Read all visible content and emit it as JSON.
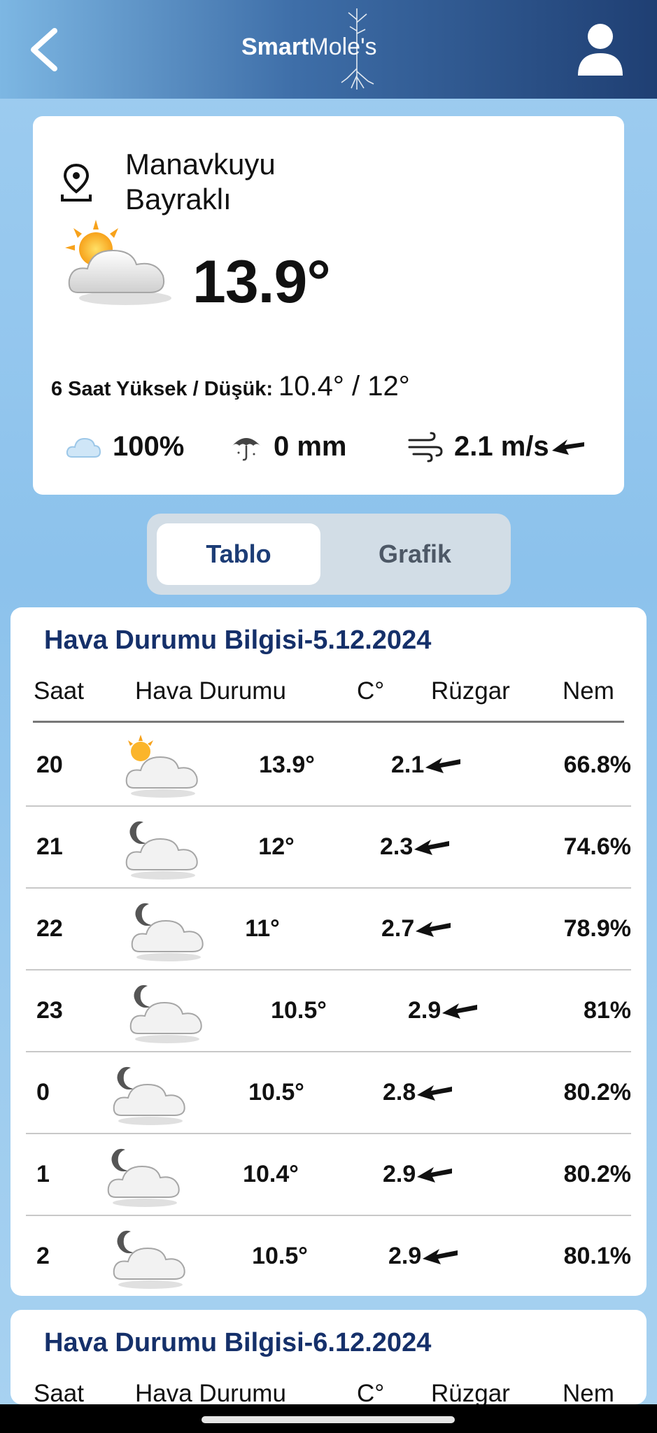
{
  "header": {
    "brand_bold": "Smart",
    "brand_light": "Mole's",
    "back_icon": "chevron-left-icon",
    "profile_icon": "user-icon"
  },
  "current": {
    "location_line1": "Manavkuyu",
    "location_line2": "Bayraklı",
    "temperature": "13.9°",
    "condition_icon": "partly-cloudy-day-icon",
    "hilo_label": "6 Saat Yüksek / Düşük:",
    "hilo_values": "10.4° / 12°",
    "cloud": "100%",
    "rain": "0 mm",
    "wind": "2.1 m/s"
  },
  "toggle": {
    "tab_table": "Tablo",
    "tab_chart": "Grafik",
    "active": "Tablo"
  },
  "table_headers": {
    "hour": "Saat",
    "weather": "Hava Durumu",
    "temp": "C°",
    "wind": "Rüzgar",
    "humidity": "Nem"
  },
  "forecast_days": [
    {
      "title": "Hava Durumu Bilgisi-5.12.2024",
      "rows": [
        {
          "hour": "20",
          "icon": "partly-cloudy-day-icon",
          "temp": "13.9°",
          "wind": "2.1",
          "humidity": "66.8%"
        },
        {
          "hour": "21",
          "icon": "partly-cloudy-night-icon",
          "temp": "12°",
          "wind": "2.3",
          "humidity": "74.6%"
        },
        {
          "hour": "22",
          "icon": "partly-cloudy-night-icon",
          "temp": "11°",
          "wind": "2.7",
          "humidity": "78.9%"
        },
        {
          "hour": "23",
          "icon": "partly-cloudy-night-icon",
          "temp": "10.5°",
          "wind": "2.9",
          "humidity": "81%"
        },
        {
          "hour": "0",
          "icon": "partly-cloudy-night-icon",
          "temp": "10.5°",
          "wind": "2.8",
          "humidity": "80.2%"
        },
        {
          "hour": "1",
          "icon": "partly-cloudy-night-icon",
          "temp": "10.4°",
          "wind": "2.9",
          "humidity": "80.2%"
        },
        {
          "hour": "2",
          "icon": "partly-cloudy-night-icon",
          "temp": "10.5°",
          "wind": "2.9",
          "humidity": "80.1%"
        }
      ]
    },
    {
      "title": "Hava Durumu Bilgisi-6.12.2024",
      "rows": []
    }
  ]
}
